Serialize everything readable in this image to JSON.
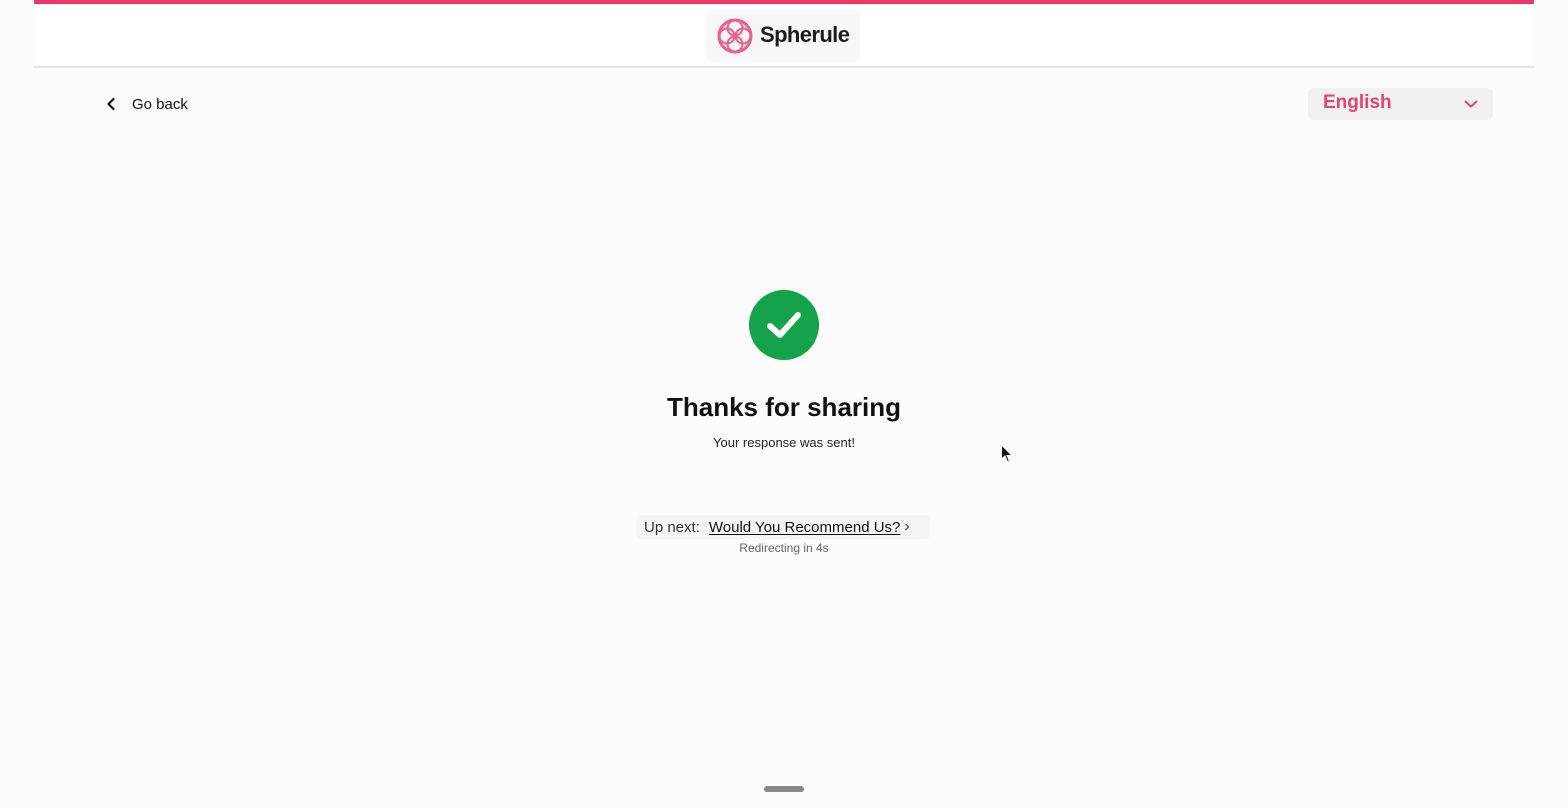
{
  "brand": {
    "name": "Spherule",
    "accent_color": "#e8376b"
  },
  "nav": {
    "back_label": "Go back"
  },
  "language": {
    "selected": "English",
    "color": "#e0456f"
  },
  "confirmation": {
    "icon": "check-circle-icon",
    "color": "#14a24a",
    "title": "Thanks for sharing",
    "message": "Your response was sent!"
  },
  "up_next": {
    "label": "Up next:",
    "link_text": "Would You Recommend Us?",
    "arrow": "›",
    "redirect_text": "Redirecting in 4s"
  }
}
